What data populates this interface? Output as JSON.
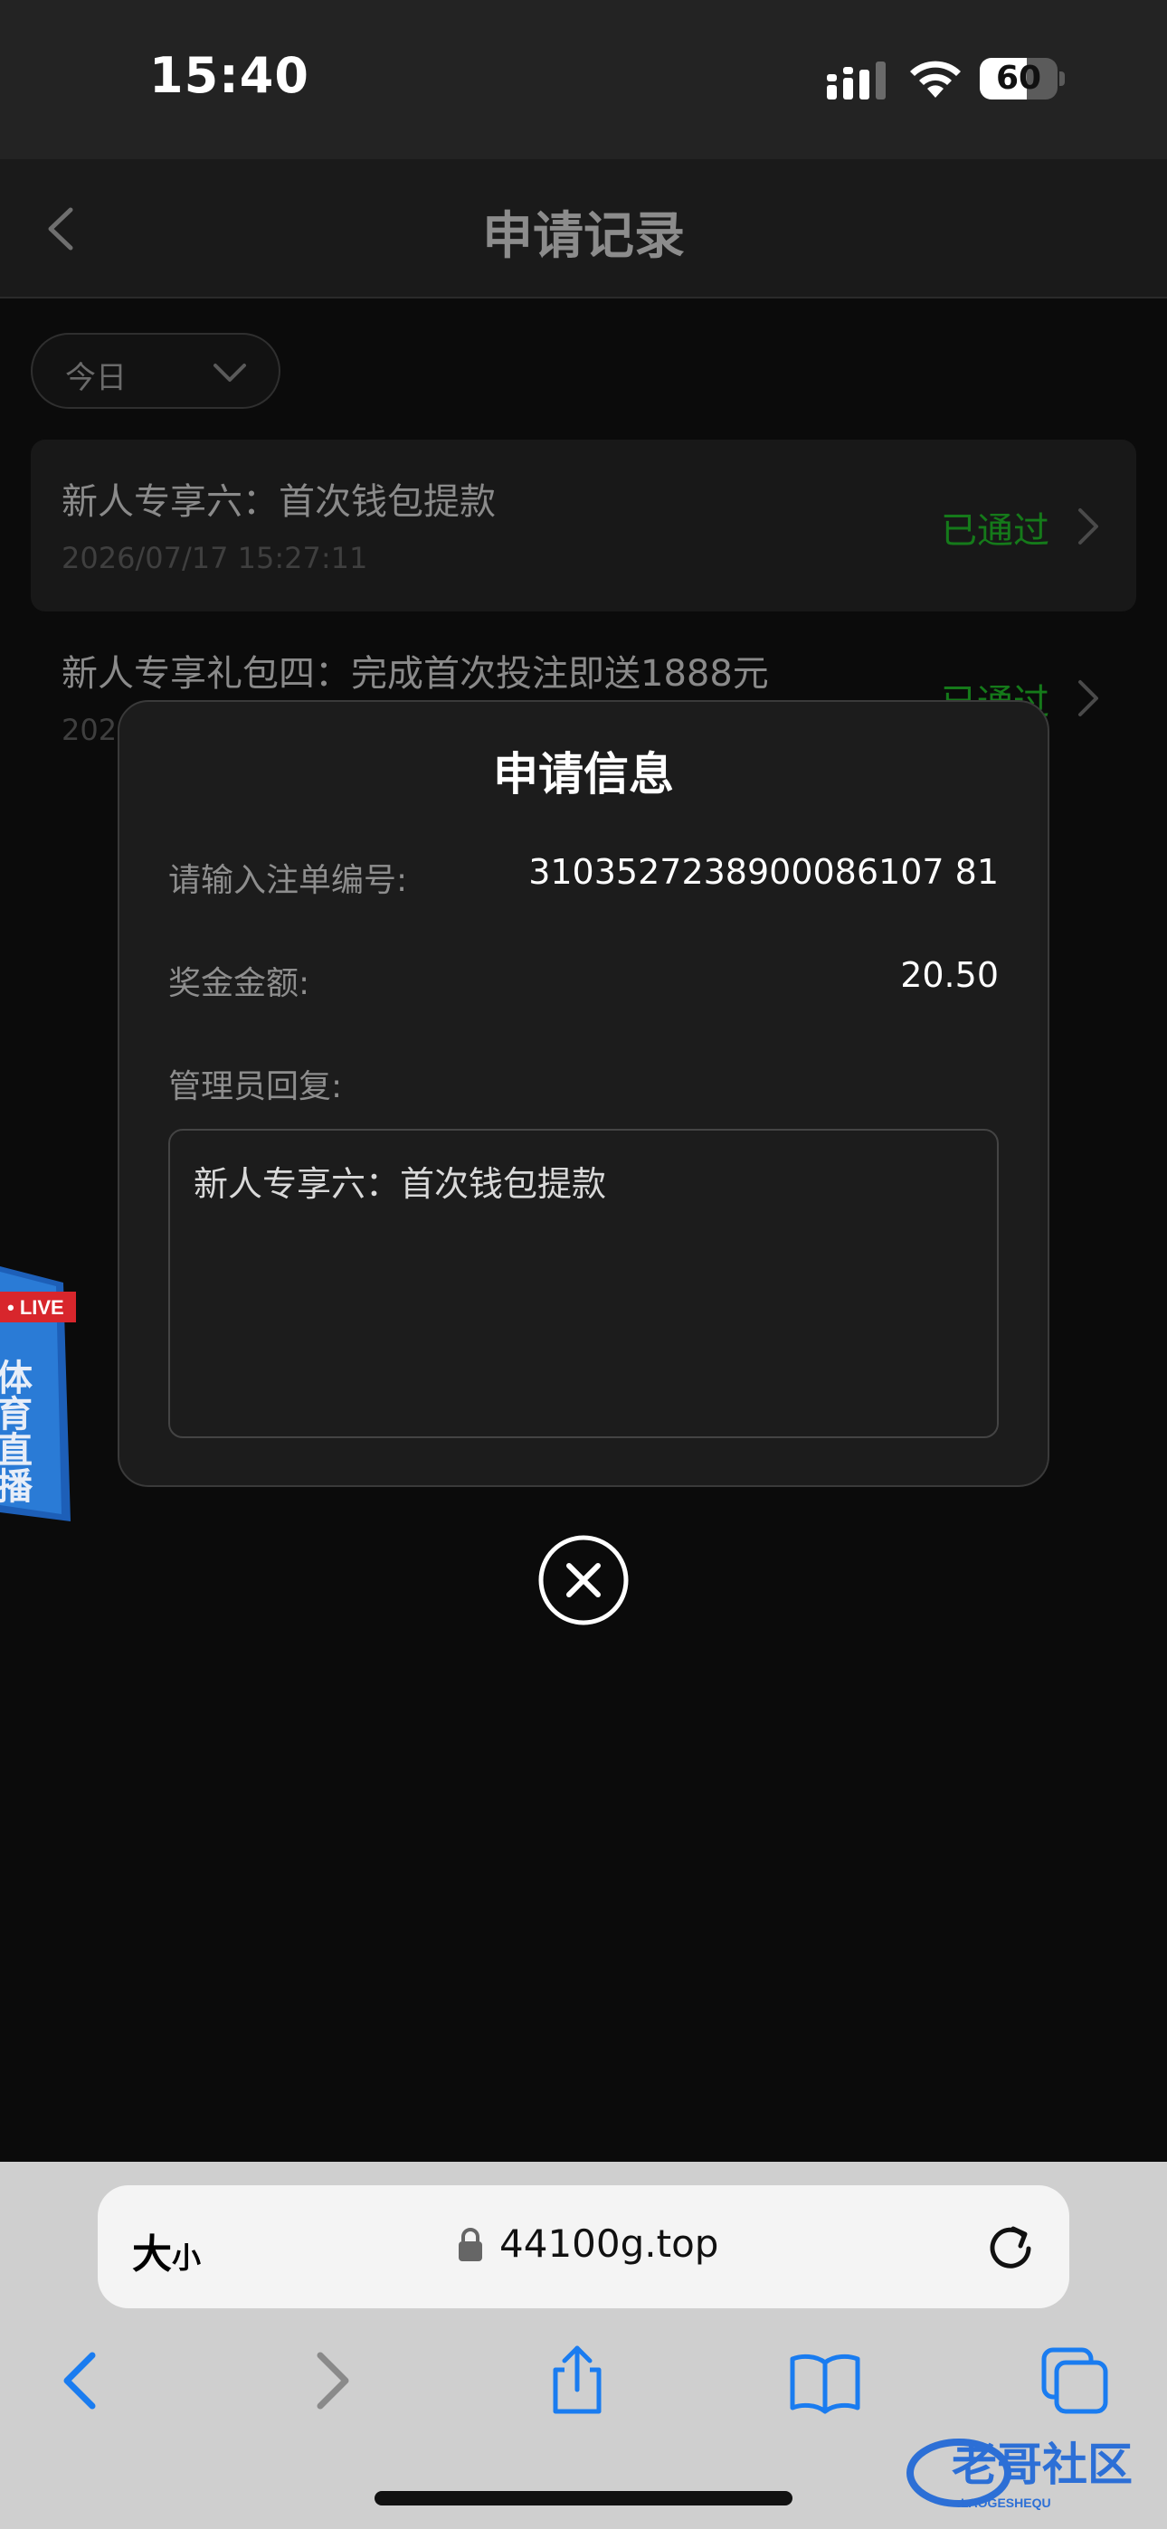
{
  "status_bar": {
    "time": "15:40",
    "battery_level": "60",
    "battery_fraction": 0.6
  },
  "page": {
    "title": "申请记录",
    "filter": {
      "selected": "今日"
    },
    "records": [
      {
        "title": "新人专享六：首次钱包提款",
        "time": "2026/07/17 15:27:11",
        "status": "已通过"
      },
      {
        "title": "新人专享礼包四：完成首次投注即送1888元",
        "time": "202",
        "status": "已通过"
      }
    ],
    "live_badge": {
      "tag": "• LIVE",
      "text": "体育直播"
    }
  },
  "modal": {
    "title": "申请信息",
    "fields": [
      {
        "label": "请输入注单编号:",
        "value": "3103527238900086107 81"
      },
      {
        "label": "奖金金额:",
        "value": "20.50"
      }
    ],
    "reply_label": "管理员回复:",
    "reply_text": "新人专享六：首次钱包提款"
  },
  "browser": {
    "text_size_big": "大",
    "text_size_small": "小",
    "url": "44100g.top"
  },
  "watermark": {
    "text": "老哥社区",
    "subtext": "LAOGESHEQU"
  },
  "colors": {
    "status_green": "#157a1a",
    "toolbar_blue": "#1a7cf0",
    "modal_bg": "#1c1c1c"
  }
}
